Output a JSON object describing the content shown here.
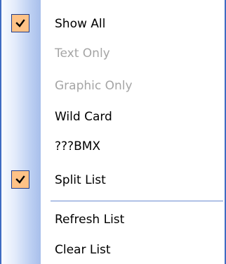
{
  "menu": {
    "show_all": {
      "label": "Show All",
      "checked": true
    },
    "text_only": {
      "label": "Text Only",
      "enabled": false
    },
    "graphic_only": {
      "label": "Graphic Only",
      "enabled": false
    },
    "wild_card": {
      "label": "Wild Card"
    },
    "wild_card_field": {
      "value": "???BMX"
    },
    "split_list": {
      "label": "Split List",
      "checked": true
    },
    "refresh_list": {
      "label": "Refresh List"
    },
    "clear_list": {
      "label": "Clear List"
    }
  },
  "colors": {
    "frame_border": "#3f6bc2",
    "check_background": "#fec286",
    "check_border": "#223d88",
    "disabled_text": "#a5a5a5",
    "separator": "#6a8cd0"
  },
  "icons": {
    "check": "checkmark-icon"
  }
}
